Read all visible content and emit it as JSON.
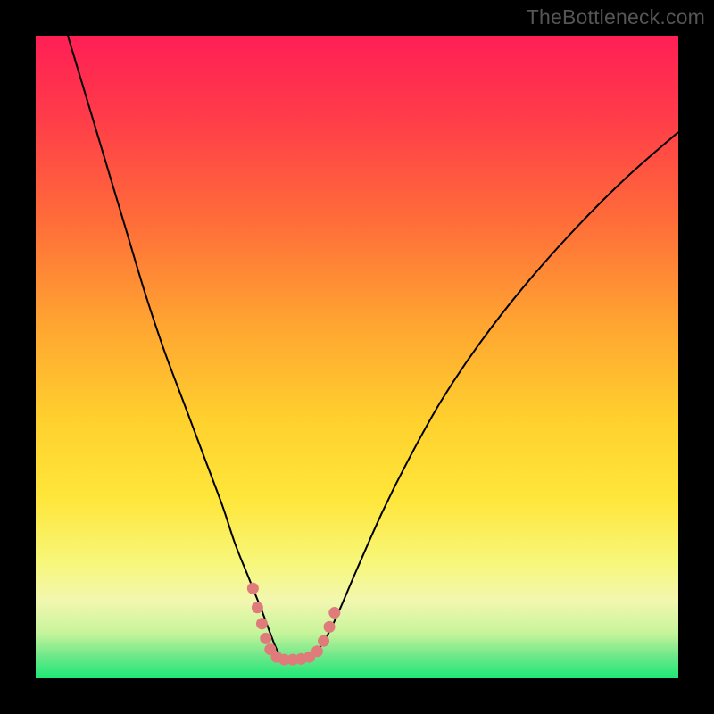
{
  "watermark": "TheBottleneck.com",
  "chart_data": {
    "type": "line",
    "title": "",
    "xlabel": "",
    "ylabel": "",
    "xlim": [
      0,
      100
    ],
    "ylim": [
      0,
      100
    ],
    "background_gradient": {
      "stops": [
        {
          "offset": 0.0,
          "color": "#ff1f55"
        },
        {
          "offset": 0.12,
          "color": "#ff3a4a"
        },
        {
          "offset": 0.28,
          "color": "#ff6a3a"
        },
        {
          "offset": 0.45,
          "color": "#ffa531"
        },
        {
          "offset": 0.6,
          "color": "#ffd12e"
        },
        {
          "offset": 0.72,
          "color": "#ffe63a"
        },
        {
          "offset": 0.82,
          "color": "#f7f77a"
        },
        {
          "offset": 0.88,
          "color": "#f2f7b0"
        },
        {
          "offset": 0.93,
          "color": "#c6f49a"
        },
        {
          "offset": 0.965,
          "color": "#6fe88a"
        },
        {
          "offset": 1.0,
          "color": "#1de876"
        }
      ]
    },
    "series": [
      {
        "name": "bottleneck-curve",
        "color": "#000000",
        "width": 2.0,
        "x": [
          5,
          8,
          11,
          14,
          17,
          20,
          23,
          26,
          29,
          31,
          33,
          35,
          36.5,
          37.5,
          38.5,
          39.5,
          41,
          43,
          45,
          47,
          50,
          54,
          58,
          63,
          69,
          76,
          84,
          92,
          100
        ],
        "y": [
          100,
          90,
          80,
          70,
          60,
          51,
          43,
          35,
          27,
          21,
          16,
          11,
          7,
          4.5,
          3.2,
          3.0,
          3.0,
          3.5,
          6,
          10,
          17,
          26,
          34,
          43,
          52,
          61,
          70,
          78,
          85
        ]
      }
    ],
    "highlight": {
      "name": "match-points",
      "color": "#e07b7b",
      "radius": 6.5,
      "points": [
        {
          "x": 33.8,
          "y": 14.0
        },
        {
          "x": 34.5,
          "y": 11.0
        },
        {
          "x": 35.2,
          "y": 8.5
        },
        {
          "x": 35.8,
          "y": 6.2
        },
        {
          "x": 36.5,
          "y": 4.5
        },
        {
          "x": 37.5,
          "y": 3.3
        },
        {
          "x": 38.7,
          "y": 2.9
        },
        {
          "x": 40.0,
          "y": 2.9
        },
        {
          "x": 41.3,
          "y": 3.0
        },
        {
          "x": 42.6,
          "y": 3.3
        },
        {
          "x": 43.8,
          "y": 4.2
        },
        {
          "x": 44.8,
          "y": 5.8
        },
        {
          "x": 45.7,
          "y": 8.0
        },
        {
          "x": 46.5,
          "y": 10.2
        }
      ]
    }
  }
}
